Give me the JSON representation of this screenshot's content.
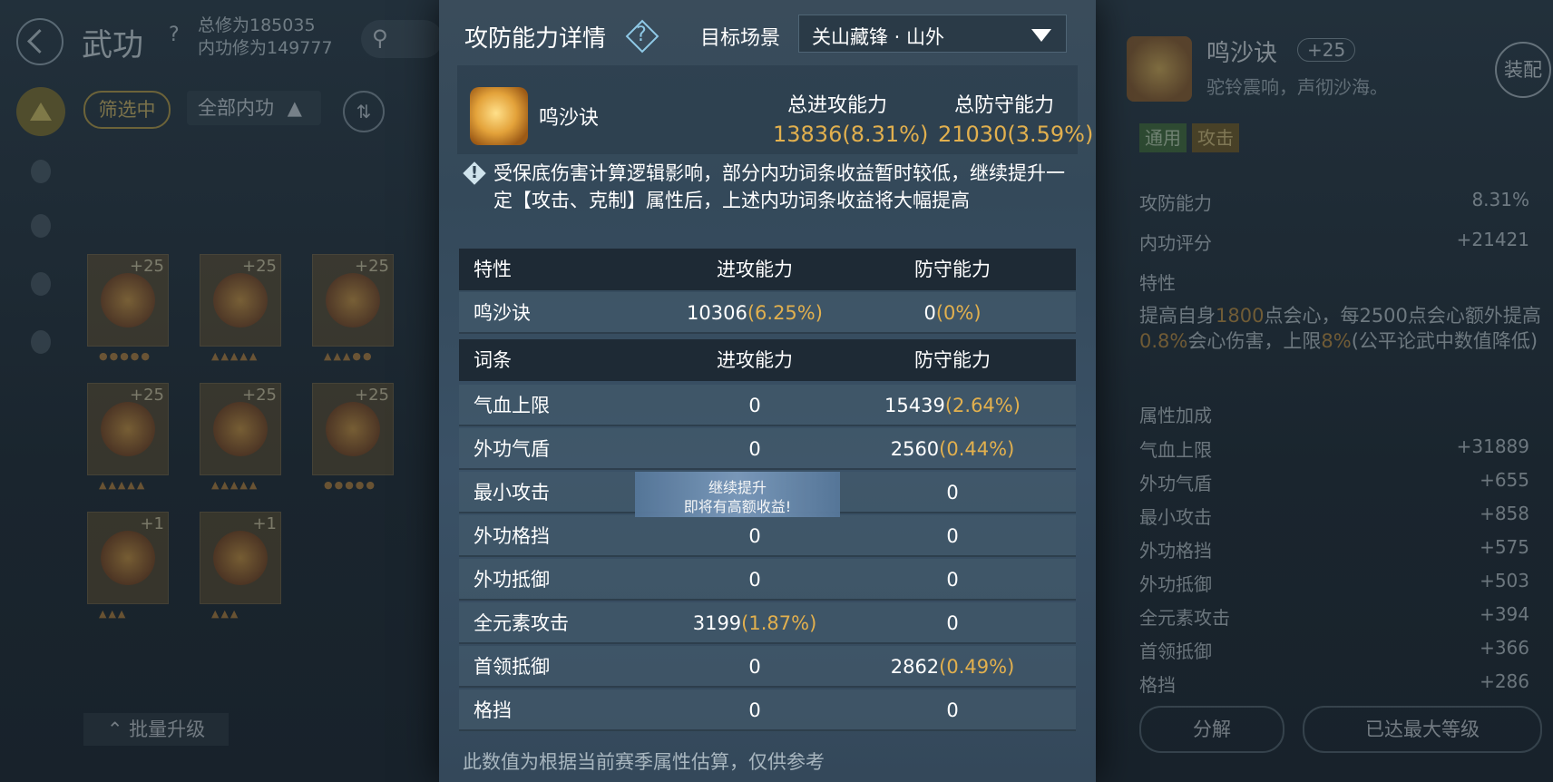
{
  "background_left": {
    "title": "武功",
    "help": "?",
    "cultivation_total": "总修为185035",
    "cultivation_inner": "内功修为149777",
    "search_glyph": "搜",
    "filter_label": "筛选中",
    "all_inner_label": "全部内功",
    "batch_upgrade_label": "批量升级",
    "cards": [
      {
        "level": "+25"
      },
      {
        "level": "+25"
      },
      {
        "level": "+25"
      },
      {
        "level": "+25"
      },
      {
        "level": "+25"
      },
      {
        "level": "+25"
      },
      {
        "level": "+1"
      },
      {
        "level": "+1"
      }
    ]
  },
  "background_right": {
    "name": "鸣沙诀",
    "level": "+25",
    "subtitle": "驼铃震响，声彻沙海。",
    "equip_label": "装配",
    "tags": [
      "通用",
      "攻击"
    ],
    "rows": [
      {
        "label": "攻防能力",
        "value": "8.31%"
      },
      {
        "label": "内功评分",
        "value": "+21421"
      }
    ],
    "trait_header": "特性",
    "trait_text_parts": [
      "提高自身",
      "1800",
      "点会心，每2500点会心额外提高",
      "0.8%",
      "会心伤害，上限",
      "8%",
      "(公平论武中数值降低)"
    ],
    "attr_header": "属性加成",
    "attrs": [
      {
        "label": "气血上限",
        "value": "+31889"
      },
      {
        "label": "外功气盾",
        "value": "+655"
      },
      {
        "label": "最小攻击",
        "value": "+858"
      },
      {
        "label": "外功格挡",
        "value": "+575"
      },
      {
        "label": "外功抵御",
        "value": "+503"
      },
      {
        "label": "全元素攻击",
        "value": "+394"
      },
      {
        "label": "首领抵御",
        "value": "+366"
      },
      {
        "label": "格挡",
        "value": "+286"
      }
    ],
    "decompose_label": "分解",
    "max_level_label": "已达最大等级"
  },
  "modal": {
    "title": "攻防能力详情",
    "help": "?",
    "scene_label": "目标场景",
    "scene_value": "关山藏锋 · 山外",
    "skill_name": "鸣沙诀",
    "total_attack_label": "总进攻能力",
    "total_defense_label": "总防守能力",
    "total_attack_value": "13836(8.31%)",
    "total_defense_value": "21030(3.59%)",
    "notice": "受保底伤害计算逻辑影响，部分内功词条收益暂时较低，继续提升一定【攻击、克制】属性后，上述内功词条收益将大幅提高",
    "trait_table": {
      "headers": [
        "特性",
        "进攻能力",
        "防守能力"
      ],
      "rows": [
        {
          "name": "鸣沙诀",
          "atk": "10306",
          "atk_pct": "(6.25%)",
          "def": "0",
          "def_pct": "(0%)"
        }
      ]
    },
    "entry_table": {
      "headers": [
        "词条",
        "进攻能力",
        "防守能力"
      ],
      "rows": [
        {
          "name": "气血上限",
          "atk": "0",
          "atk_pct": "",
          "def": "15439",
          "def_pct": "(2.64%)"
        },
        {
          "name": "外功气盾",
          "atk": "0",
          "atk_pct": "",
          "def": "2560",
          "def_pct": "(0.44%)"
        },
        {
          "name": "最小攻击",
          "atk": "",
          "atk_pct": "",
          "def": "0",
          "def_pct": ""
        },
        {
          "name": "外功格挡",
          "atk": "0",
          "atk_pct": "",
          "def": "0",
          "def_pct": ""
        },
        {
          "name": "外功抵御",
          "atk": "0",
          "atk_pct": "",
          "def": "0",
          "def_pct": ""
        },
        {
          "name": "全元素攻击",
          "atk": "3199",
          "atk_pct": "(1.87%)",
          "def": "0",
          "def_pct": ""
        },
        {
          "name": "首领抵御",
          "atk": "0",
          "atk_pct": "",
          "def": "2862",
          "def_pct": "(0.49%)"
        },
        {
          "name": "格挡",
          "atk": "0",
          "atk_pct": "",
          "def": "0",
          "def_pct": ""
        }
      ]
    },
    "tooltip_line1": "继续提升",
    "tooltip_line2": "即将有高额收益!",
    "footer": "此数值为根据当前赛季属性估算，仅供参考"
  },
  "colors": {
    "accent_gold": "#e2b04e",
    "modal_bg": "#3a4c5b",
    "table_header": "#1e2a35"
  }
}
